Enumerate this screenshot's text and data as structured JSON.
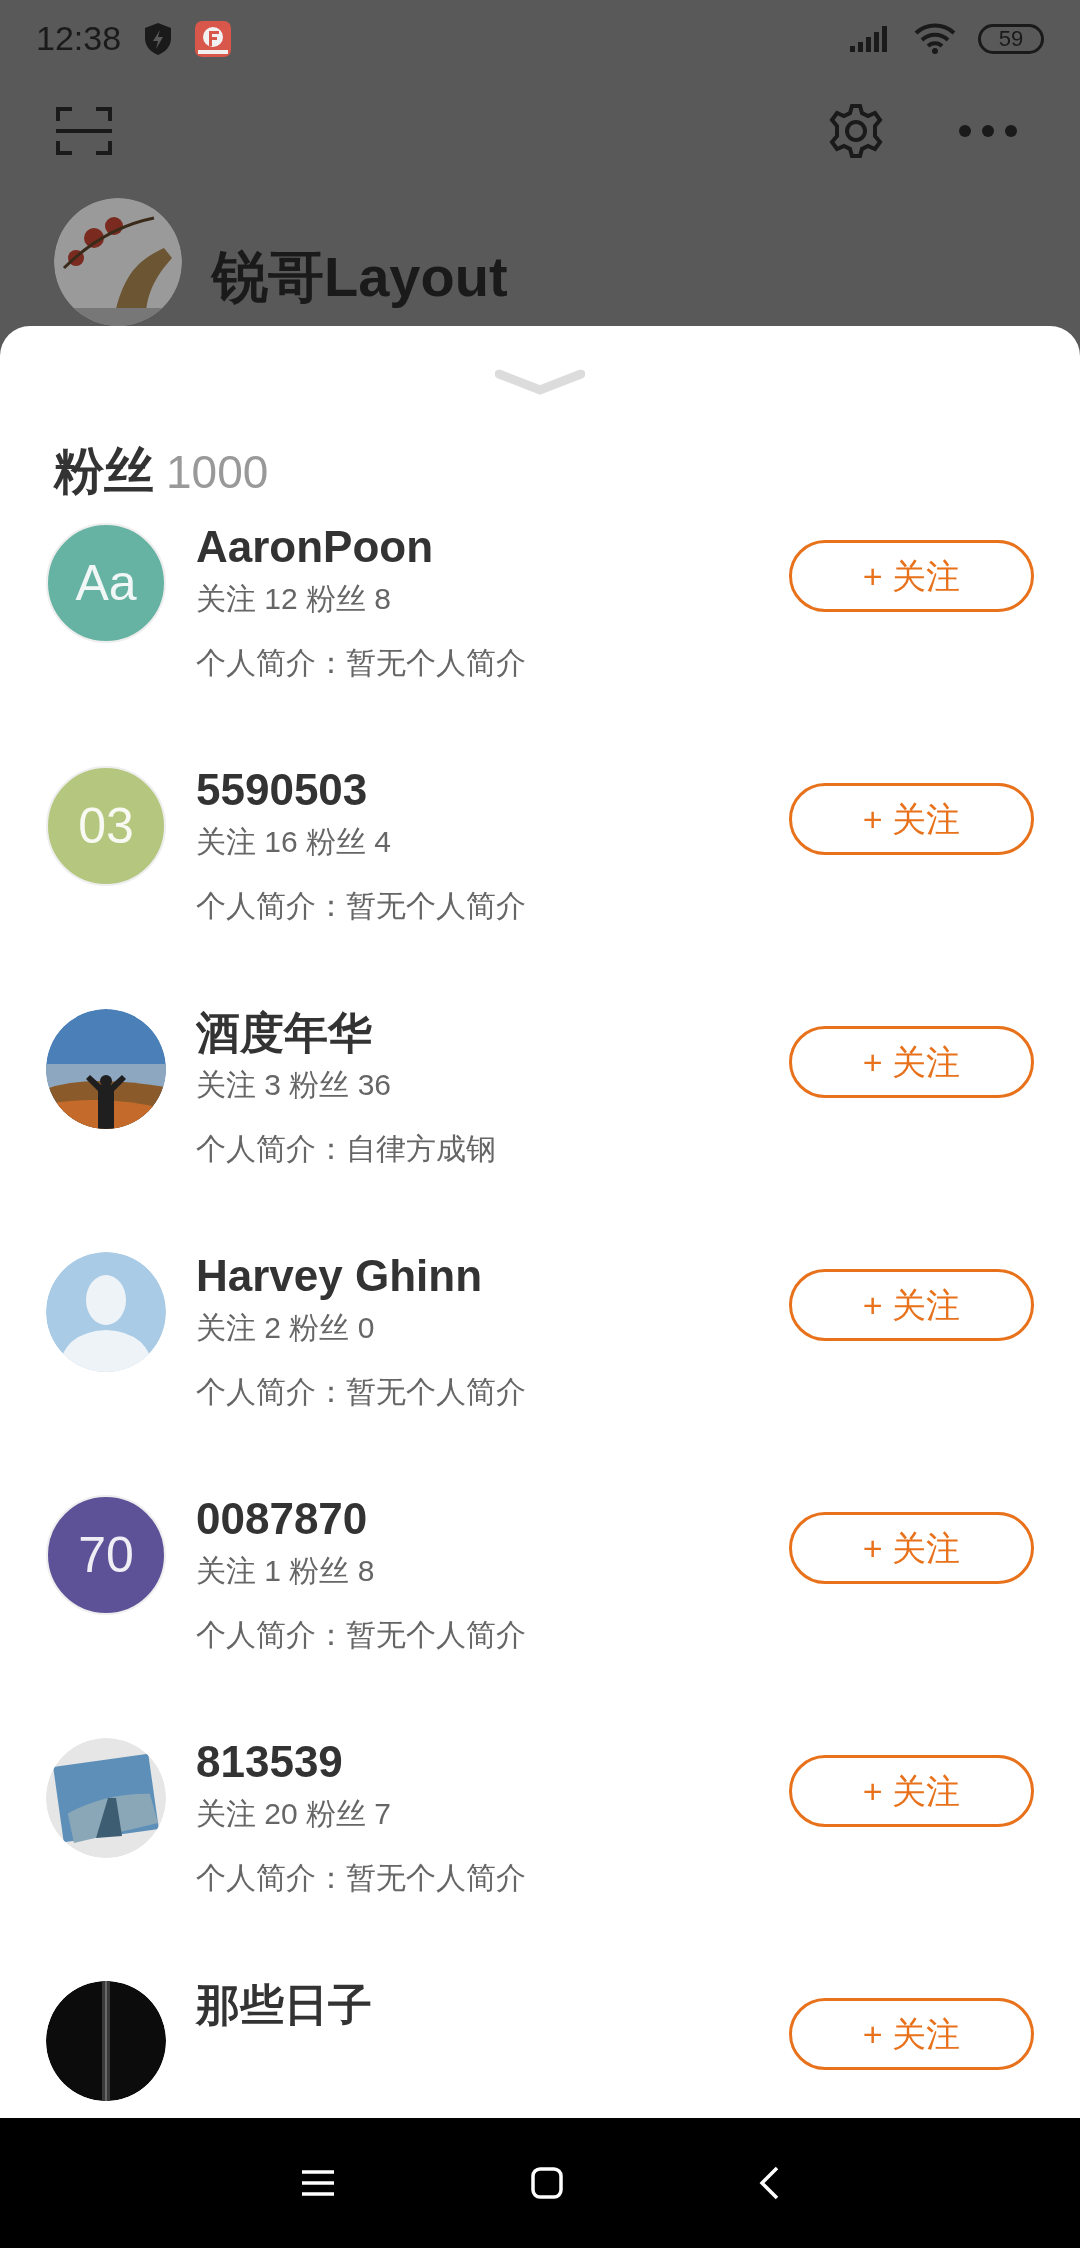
{
  "status_bar": {
    "time": "12:38",
    "battery": "59"
  },
  "profile": {
    "name": "锐哥Layout"
  },
  "sheet": {
    "title": "粉丝",
    "count": "1000"
  },
  "followers": [
    {
      "name": "AaronPoon",
      "stats": "关注 12 粉丝 8",
      "bio": "个人简介：暂无个人简介",
      "avatar": {
        "kind": "initials",
        "text": "Aa",
        "color": "#66b3a3"
      },
      "button": "+ 关注"
    },
    {
      "name": "5590503",
      "stats": "关注 16 粉丝 4",
      "bio": "个人简介：暂无个人简介",
      "avatar": {
        "kind": "initials",
        "text": "03",
        "color": "#b5c77e"
      },
      "button": "+ 关注"
    },
    {
      "name": "酒度年华",
      "stats": "关注 3 粉丝 36",
      "bio": "个人简介：自律方成钢",
      "button": "+ 关注"
    },
    {
      "name": "Harvey Ghinn",
      "stats": "关注 2 粉丝 0",
      "bio": "个人简介：暂无个人简介",
      "avatar": {
        "kind": "silhouette"
      },
      "button": "+ 关注"
    },
    {
      "name": "0087870",
      "stats": "关注 1 粉丝 8",
      "bio": "个人简介：暂无个人简介",
      "avatar": {
        "kind": "initials",
        "text": "70",
        "color": "#5d5298"
      },
      "button": "+ 关注"
    },
    {
      "name": "813539",
      "stats": "关注 20 粉丝 7",
      "bio": "个人简介：暂无个人简介",
      "button": "+ 关注"
    },
    {
      "name": "那些日子",
      "button": "+ 关注"
    }
  ]
}
